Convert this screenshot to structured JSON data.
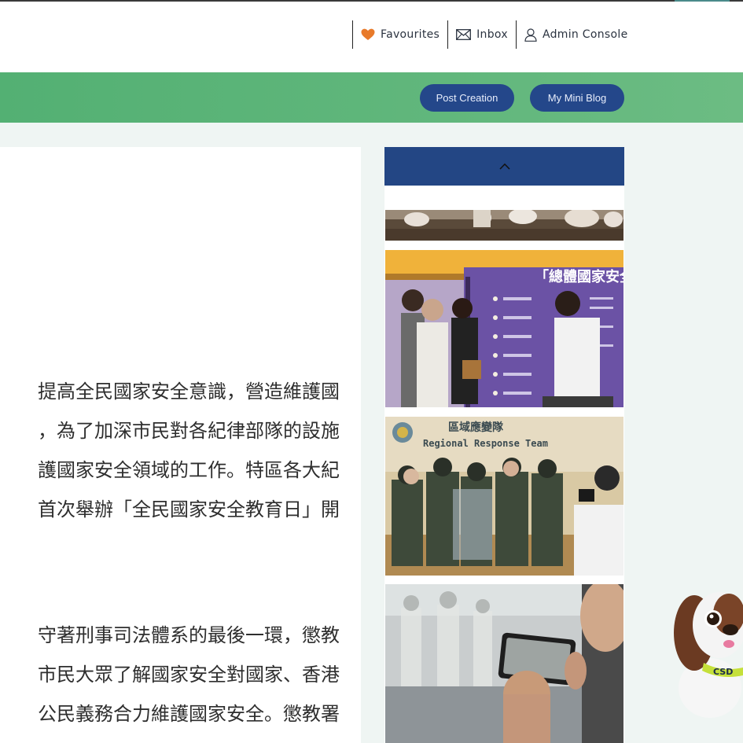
{
  "header": {
    "links": {
      "favourites": "Favourites",
      "inbox": "Inbox",
      "admin": "Admin Console"
    },
    "icons": {
      "favourites": "heart-icon",
      "inbox": "mail-icon",
      "admin": "user-icon"
    }
  },
  "toolbar": {
    "post_creation": "Post Creation",
    "mini_blog": "My Mini Blog"
  },
  "article": {
    "paragraph1": [
      "提高全民國家安全意識，營造維護國",
      "，為了加深市民對各紀律部隊的設施",
      "護國家安全領域的工作。特區各大紀",
      "首次舉辦「全民國家安全教育日」開"
    ],
    "paragraph2": [
      "守著刑事司法體系的最後一環，懲教",
      "市民大眾了解國家安全對國家、香港",
      "公民義務合力維護國家安全。懲教署"
    ]
  },
  "gallery": {
    "up_icon": "chevron-up-icon",
    "photo2": {
      "banner_title": "「總體國家安全觀」"
    },
    "photo3": {
      "sign_title": "區域應變隊",
      "sign_subtitle": "Regional Response Team"
    }
  },
  "mascot": {
    "collar_text": "CSD"
  },
  "colors": {
    "green_bar": "#5db579",
    "pill_blue": "#24478a",
    "gallery_header": "#234684",
    "heart": "#e87a2a"
  }
}
